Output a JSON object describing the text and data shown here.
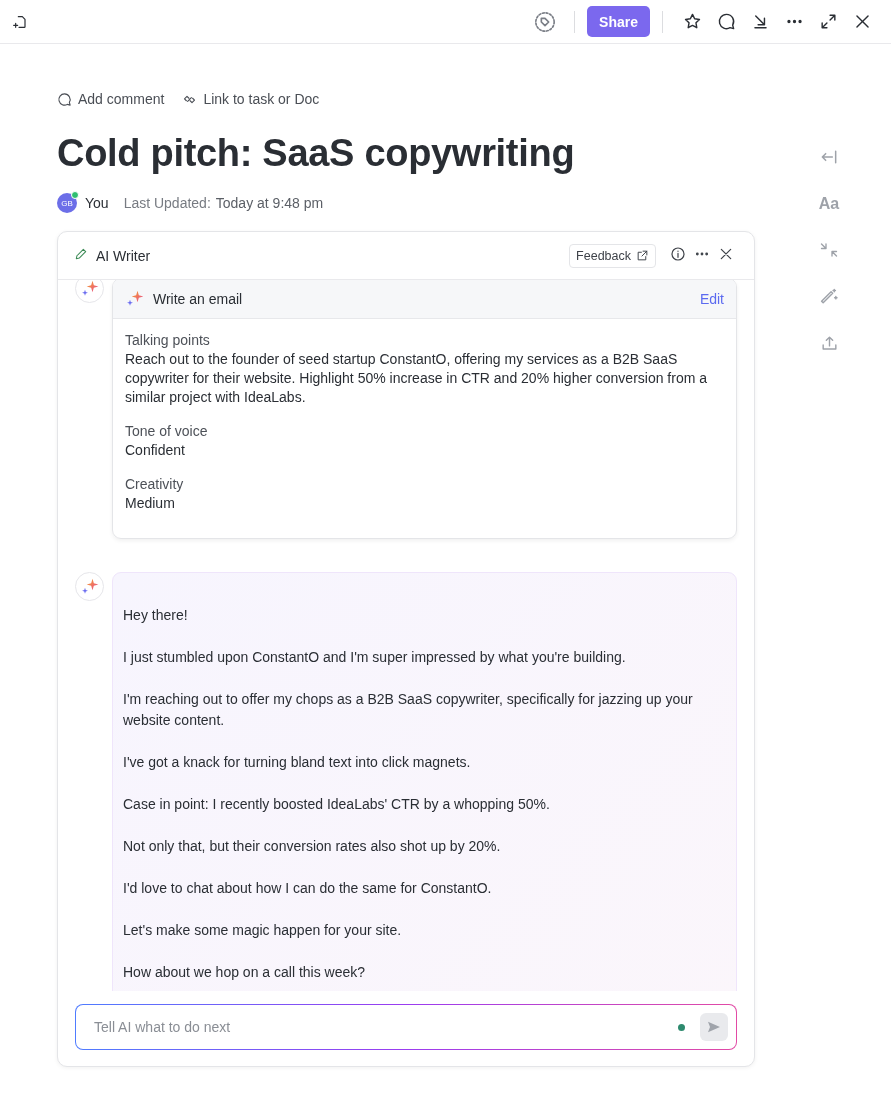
{
  "toolbar": {
    "share_label": "Share"
  },
  "actions": [
    {
      "label": "Add comment"
    },
    {
      "label": "Link to task or Doc"
    }
  ],
  "title": "Cold pitch: SaaS copywriting",
  "author": {
    "initials": "GB",
    "name": "You",
    "online": true
  },
  "last_updated": {
    "label": "Last Updated:",
    "value": "Today at 9:48 pm"
  },
  "rail": {
    "font_label": "Aa"
  },
  "ai_panel": {
    "title": "AI Writer",
    "feedback": "Feedback",
    "request": {
      "title": "Write an email",
      "edit": "Edit",
      "fields": [
        {
          "label": "Talking points",
          "value": "Reach out to the founder of seed startup ConstantO, offering my services as a B2B SaaS copywriter for their website. Highlight 50% increase in CTR and 20% higher conversion from a similar project with IdeaLabs."
        },
        {
          "label": "Tone of voice",
          "value": "Confident"
        },
        {
          "label": "Creativity",
          "value": "Medium"
        }
      ]
    },
    "response": {
      "paragraphs": [
        "Hey there!",
        "I just stumbled upon ConstantO and I'm super impressed by what you're building.",
        "I'm reaching out to offer my chops as a B2B SaaS copywriter, specifically for jazzing up your website content.",
        "I've got a knack for turning bland text into click magnets.",
        "Case in point: I recently boosted IdeaLabs' CTR by a whopping 50%.",
        "Not only that, but their conversion rates also shot up by 20%.",
        "I'd love to chat about how I can do the same for ConstantO.",
        "Let's make some magic happen for your site.",
        "How about we hop on a call this week?"
      ]
    },
    "input": {
      "placeholder": "Tell AI what to do next"
    }
  }
}
